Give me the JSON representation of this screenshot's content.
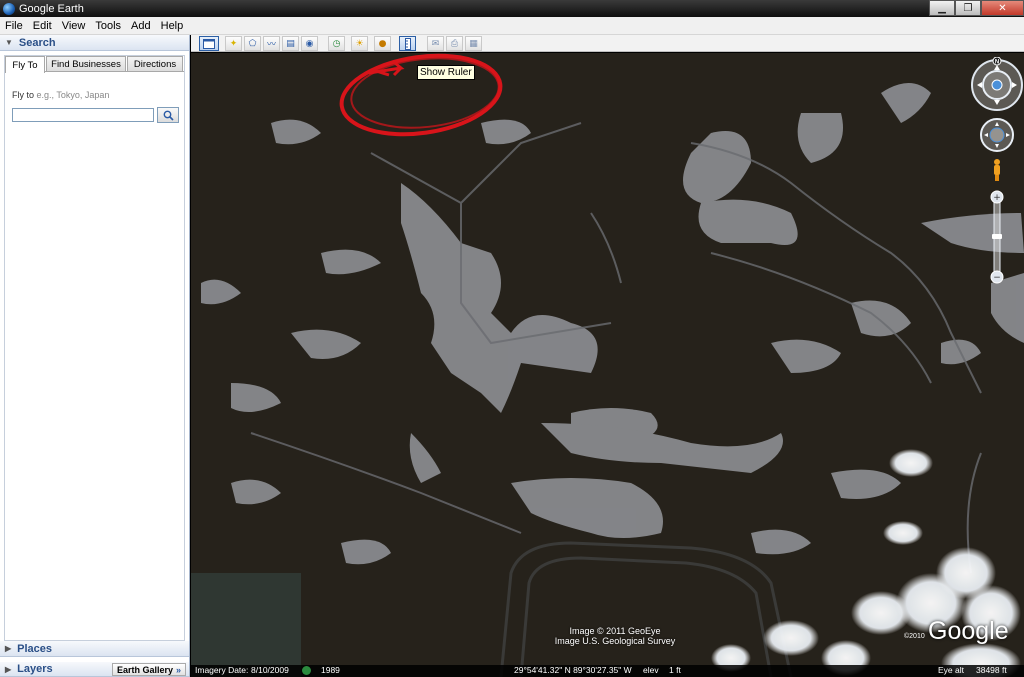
{
  "window": {
    "title": "Google Earth",
    "controls": {
      "minimize": "▁",
      "maximize": "❐",
      "close": "✕"
    }
  },
  "menu": [
    "File",
    "Edit",
    "View",
    "Tools",
    "Add",
    "Help"
  ],
  "sidebar": {
    "search_header": "Search",
    "tabs": [
      "Fly To",
      "Find Businesses",
      "Directions"
    ],
    "flyto_label": "Fly to",
    "flyto_hint": "e.g., Tokyo, Japan",
    "flyto_value": "",
    "places_header": "Places",
    "layers_header": "Layers",
    "earth_gallery": "Earth Gallery",
    "earth_gallery_chevron": "»"
  },
  "toolbar": {
    "buttons": [
      {
        "name": "sidebar",
        "icon": "sidebar-icon"
      },
      {
        "name": "placemark",
        "icon": "pushpin-icon"
      },
      {
        "name": "polygon",
        "icon": "polygon-icon"
      },
      {
        "name": "path",
        "icon": "path-icon"
      },
      {
        "name": "image-overlay",
        "icon": "overlay-icon"
      },
      {
        "name": "record-tour",
        "icon": "tour-icon"
      },
      {
        "name": "historical-imagery",
        "icon": "clock-icon"
      },
      {
        "name": "sunlight",
        "icon": "sun-icon"
      },
      {
        "name": "switch-sky",
        "icon": "planet-icon"
      },
      {
        "name": "ruler",
        "icon": "ruler-icon"
      },
      {
        "name": "email",
        "icon": "email-icon"
      },
      {
        "name": "print",
        "icon": "print-icon"
      },
      {
        "name": "view-in-maps",
        "icon": "maps-icon"
      }
    ],
    "tooltip": "Show Ruler"
  },
  "map": {
    "credits_line1": "Image © 2011 GeoEye",
    "credits_line2": "Image U.S. Geological Survey",
    "copyright_year": "©2010",
    "logo": "Google"
  },
  "status": {
    "imagery_date_label": "Imagery Date:",
    "imagery_date": "8/10/2009",
    "year": "1989",
    "coords": "29°54'41.32\" N   89°30'27.35\" W",
    "elev_label": "elev",
    "elev_value": "1 ft",
    "eye_alt_label": "Eye alt",
    "eye_alt_value": "38498 ft"
  },
  "colors": {
    "annotation_red": "#d8141a",
    "ground": "#26221b",
    "water": "#8b8d91"
  }
}
